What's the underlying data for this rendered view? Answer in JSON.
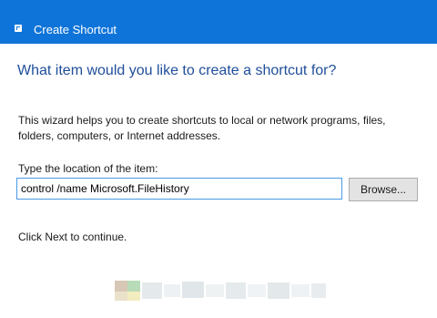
{
  "window": {
    "title": "Create Shortcut",
    "icon": "shortcut-icon"
  },
  "wizard": {
    "heading": "What item would you like to create a shortcut for?",
    "description": "This wizard helps you to create shortcuts to local or network programs, files, folders, computers, or Internet addresses.",
    "location_label": "Type the location of the item:",
    "location_value": "control /name Microsoft.FileHistory",
    "browse_label": "Browse...",
    "continue_hint": "Click Next to continue."
  },
  "colors": {
    "titlebar": "#0f74d9",
    "heading": "#1f4e9a",
    "input_border": "#4a9ae6"
  }
}
